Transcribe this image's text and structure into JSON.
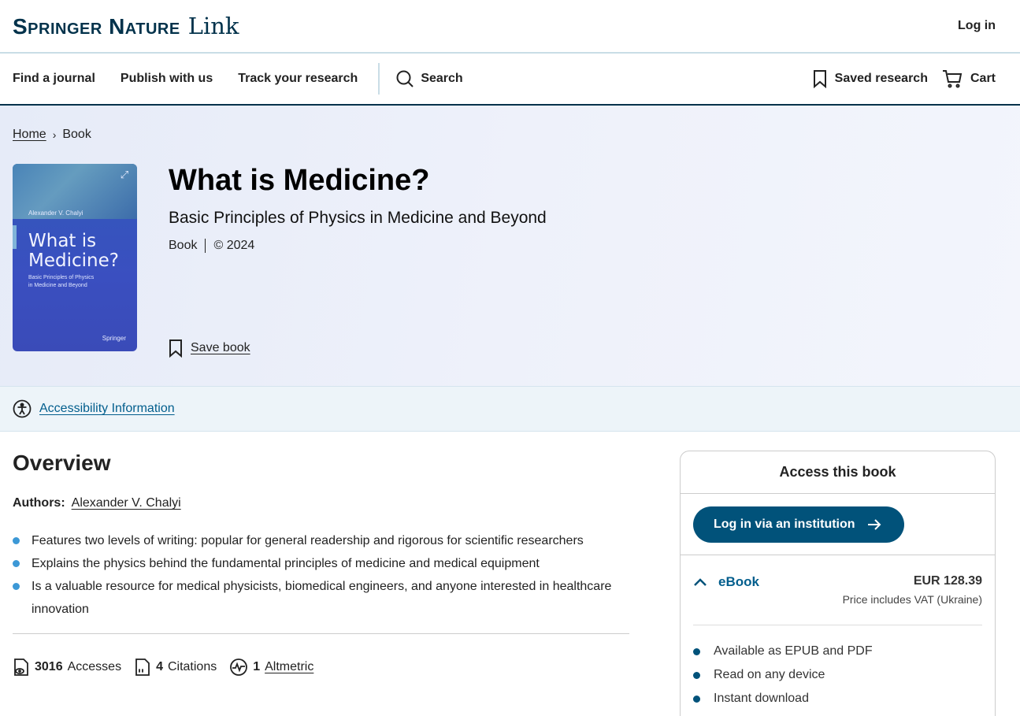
{
  "brand": {
    "main": "Springer Nature",
    "sub": "Link"
  },
  "header": {
    "login": "Log in"
  },
  "nav": {
    "links": [
      "Find a journal",
      "Publish with us",
      "Track your research"
    ],
    "search": "Search",
    "saved": "Saved research",
    "cart": "Cart"
  },
  "breadcrumb": {
    "home": "Home",
    "current": "Book"
  },
  "cover": {
    "author": "Alexander V. Chalyi",
    "title_line1": "What is",
    "title_line2": "Medicine?",
    "subtitle_line1": "Basic Principles of Physics",
    "subtitle_line2": "in Medicine and Beyond",
    "publisher": "Springer"
  },
  "book": {
    "title": "What is Medicine?",
    "subtitle": "Basic Principles of Physics in Medicine and Beyond",
    "type": "Book",
    "year": "© 2024",
    "save": "Save book"
  },
  "a11y": {
    "label": "Accessibility Information"
  },
  "overview": {
    "title": "Overview",
    "authors_label": "Authors:",
    "author": "Alexander V. Chalyi",
    "features": [
      "Features two levels of writing: popular for general readership and rigorous for scientific researchers",
      "Explains the physics behind the fundamental principles of medicine and medical equipment",
      "Is a valuable resource for medical physicists, biomedical engineers, and anyone interested in healthcare innovation"
    ],
    "metrics": {
      "accesses_num": "3016",
      "accesses_label": "Accesses",
      "citations_num": "4",
      "citations_label": "Citations",
      "altmetric_num": "1",
      "altmetric_label": "Altmetric"
    }
  },
  "access": {
    "title": "Access this book",
    "login_institution": "Log in via an institution",
    "ebook_label": "eBook",
    "price": "EUR 128.39",
    "vat": "Price includes VAT (Ukraine)",
    "features": [
      "Available as EPUB and PDF",
      "Read on any device",
      "Instant download"
    ]
  }
}
